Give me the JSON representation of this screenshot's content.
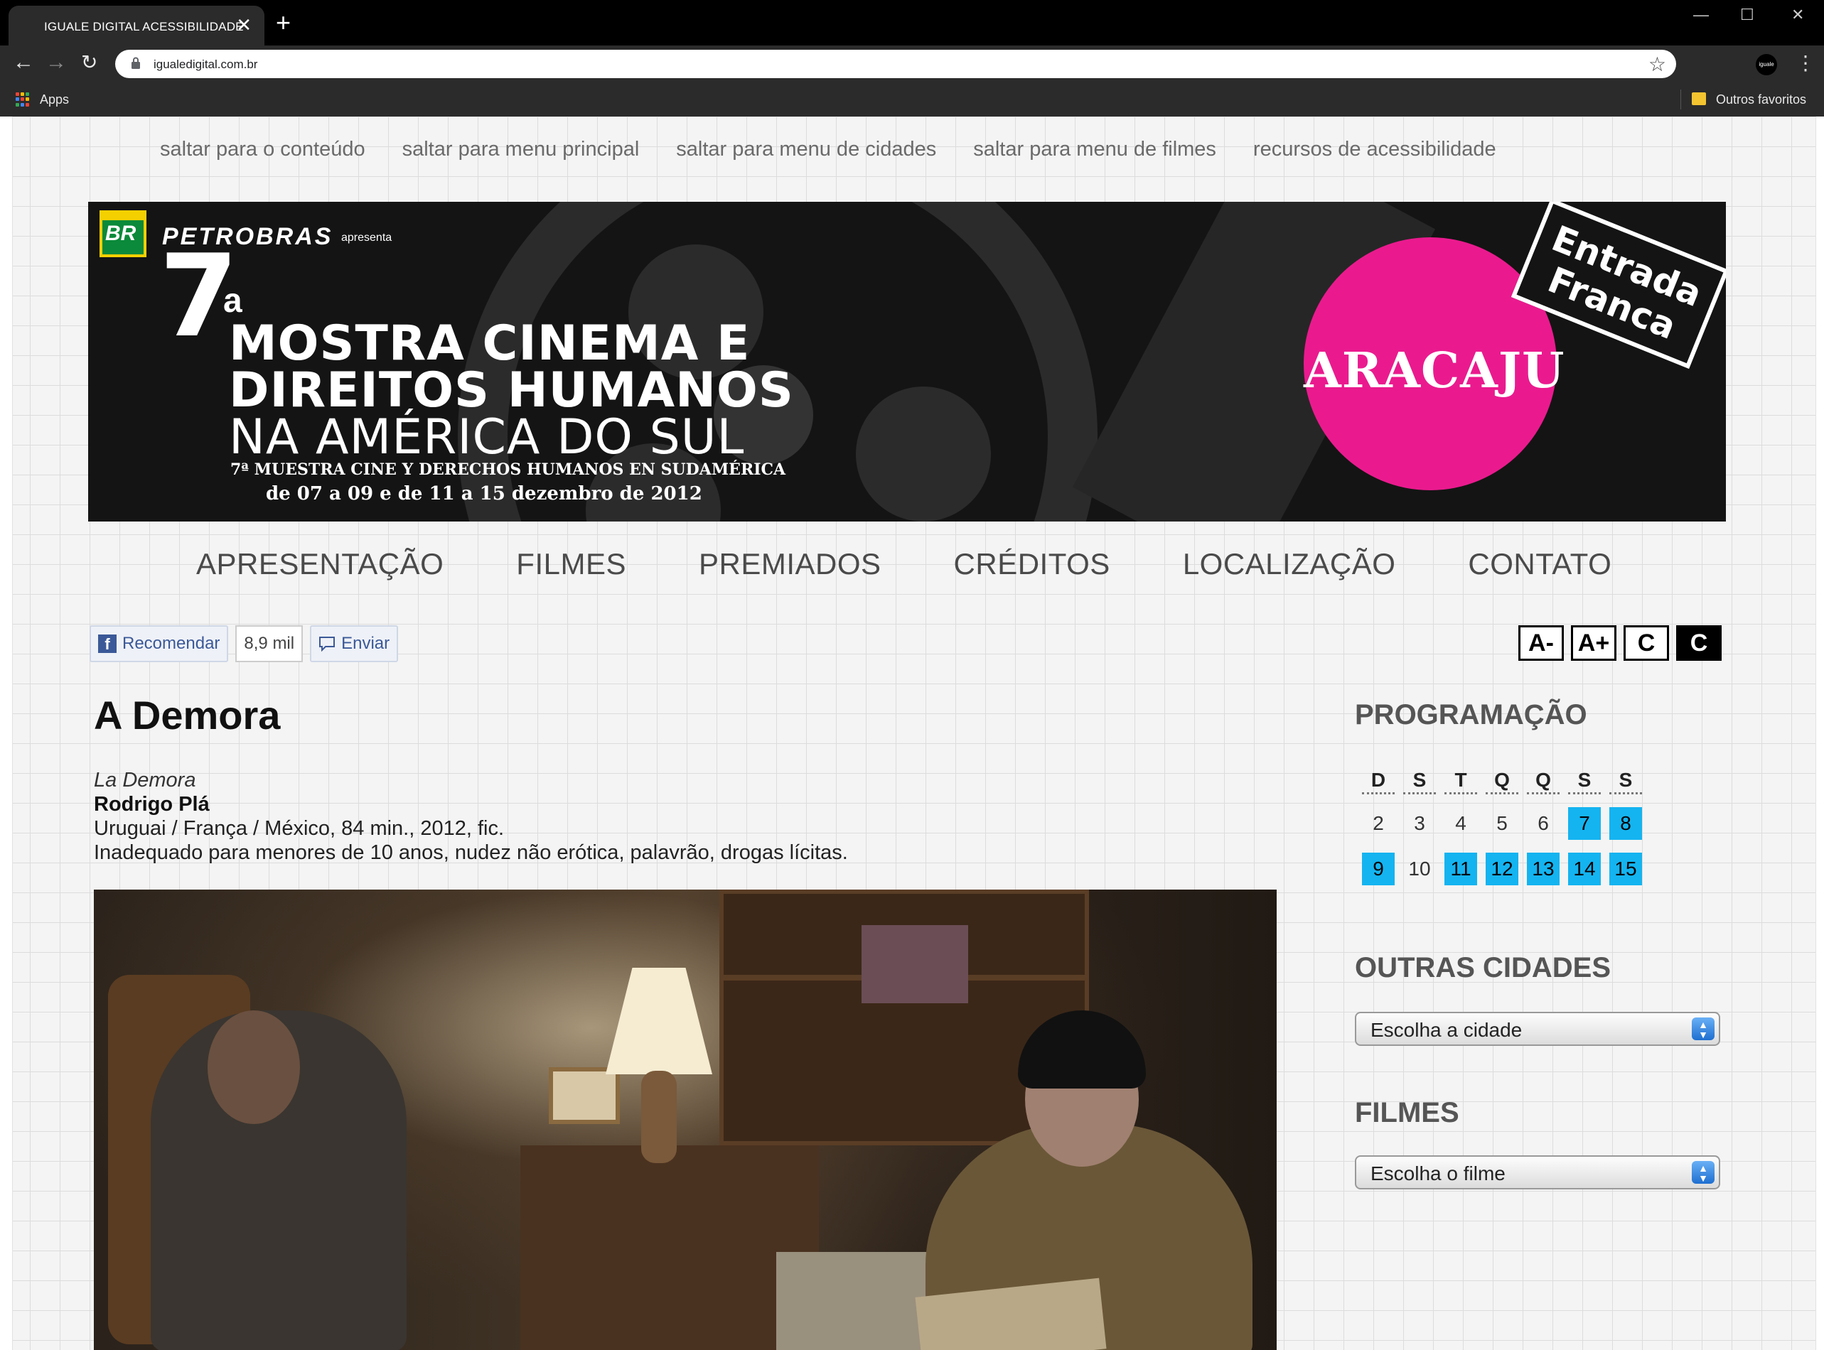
{
  "browser": {
    "tab_title": "IGUALE DIGITAL ACESSIBILIDADE",
    "tab_close": "✕",
    "new_tab": "+",
    "url": "igualedigital.com.br",
    "bookmarks_apps": "Apps",
    "bookmarks_other": "Outros favoritos",
    "profile_label": "iguale",
    "window_controls": [
      "—",
      "☐",
      "✕"
    ]
  },
  "skip_links": [
    "saltar para o conteúdo",
    "saltar para menu principal",
    "saltar para menu de cidades",
    "saltar para menu de filmes",
    "recursos de acessibilidade"
  ],
  "banner": {
    "sponsor_logo": "BR",
    "sponsor": "PETROBRAS",
    "presents": "apresenta",
    "edition_number": "7",
    "edition_suffix": "a",
    "title_lines": [
      "MOSTRA CINEMA E",
      "DIREITOS HUMANOS",
      "NA AMÉRICA DO SUL"
    ],
    "subtitle_es": "7ª MUESTRA CINE Y DERECHOS HUMANOS EN SUDAMÉRICA",
    "dates": "de 07 a 09 e de 11 a 15 dezembro de 2012",
    "city": "ARACAJU",
    "stamp_lines": [
      "Entrada",
      "Franca"
    ],
    "city_color": "#ea1a8e"
  },
  "main_nav": [
    "APRESENTAÇÃO",
    "FILMES",
    "PREMIADOS",
    "CRÉDITOS",
    "LOCALIZAÇÃO",
    "CONTATO"
  ],
  "social": {
    "recommend": "Recomendar",
    "count": "8,9 mil",
    "send": "Enviar"
  },
  "accessibility": [
    "A-",
    "A+",
    "C",
    "C"
  ],
  "film": {
    "title": "A Demora",
    "original_title": "La Demora",
    "director": "Rodrigo Plá",
    "info": "Uruguai / França / México, 84 min., 2012, fic.",
    "rating": "Inadequado para menores de 10 anos, nudez não erótica, palavrão, drogas lícitas."
  },
  "sidebar": {
    "programacao_title": "PROGRAMAÇÃO",
    "weekdays": [
      "D",
      "S",
      "T",
      "Q",
      "Q",
      "S",
      "S"
    ],
    "weeks": [
      [
        {
          "d": "2",
          "on": false
        },
        {
          "d": "3",
          "on": false
        },
        {
          "d": "4",
          "on": false
        },
        {
          "d": "5",
          "on": false
        },
        {
          "d": "6",
          "on": false
        },
        {
          "d": "7",
          "on": true
        },
        {
          "d": "8",
          "on": true
        }
      ],
      [
        {
          "d": "9",
          "on": true
        },
        {
          "d": "10",
          "on": false
        },
        {
          "d": "11",
          "on": true
        },
        {
          "d": "12",
          "on": true
        },
        {
          "d": "13",
          "on": true
        },
        {
          "d": "14",
          "on": true
        },
        {
          "d": "15",
          "on": true
        }
      ]
    ],
    "highlight_color": "#14b4f0",
    "cities_title": "OUTRAS CIDADES",
    "cities_select": "Escolha a cidade",
    "films_title": "FILMES",
    "films_select": "Escolha o filme"
  }
}
